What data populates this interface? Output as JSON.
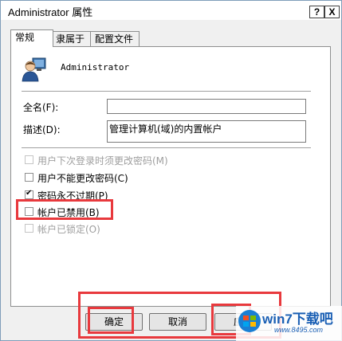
{
  "window": {
    "title": "Administrator 属性",
    "help_label": "?",
    "close_label": "X"
  },
  "tabs": [
    {
      "label": "常规",
      "active": true
    },
    {
      "label": "隶属于",
      "active": false
    },
    {
      "label": "配置文件",
      "active": false
    }
  ],
  "user": {
    "name": "Administrator",
    "icon": "user-icon"
  },
  "fields": {
    "fullname_label": "全名(F):",
    "fullname_value": "",
    "description_label": "描述(D):",
    "description_value": "管理计算机(域)的内置帐户"
  },
  "options": [
    {
      "label": "用户下次登录时须更改密码(M)",
      "checked": false,
      "disabled": true
    },
    {
      "label": "用户不能更改密码(C)",
      "checked": false,
      "disabled": false
    },
    {
      "label": "密码永不过期(P)",
      "checked": true,
      "disabled": false
    },
    {
      "label": "帐户已禁用(B)",
      "checked": false,
      "disabled": false
    },
    {
      "label": "帐户已锁定(O)",
      "checked": false,
      "disabled": true
    }
  ],
  "buttons": {
    "ok": "确定",
    "cancel": "取消",
    "apply": "应用"
  },
  "highlight_color": "#e8393d",
  "watermark": {
    "text": "win7下载吧",
    "url": "www.8495.com"
  }
}
